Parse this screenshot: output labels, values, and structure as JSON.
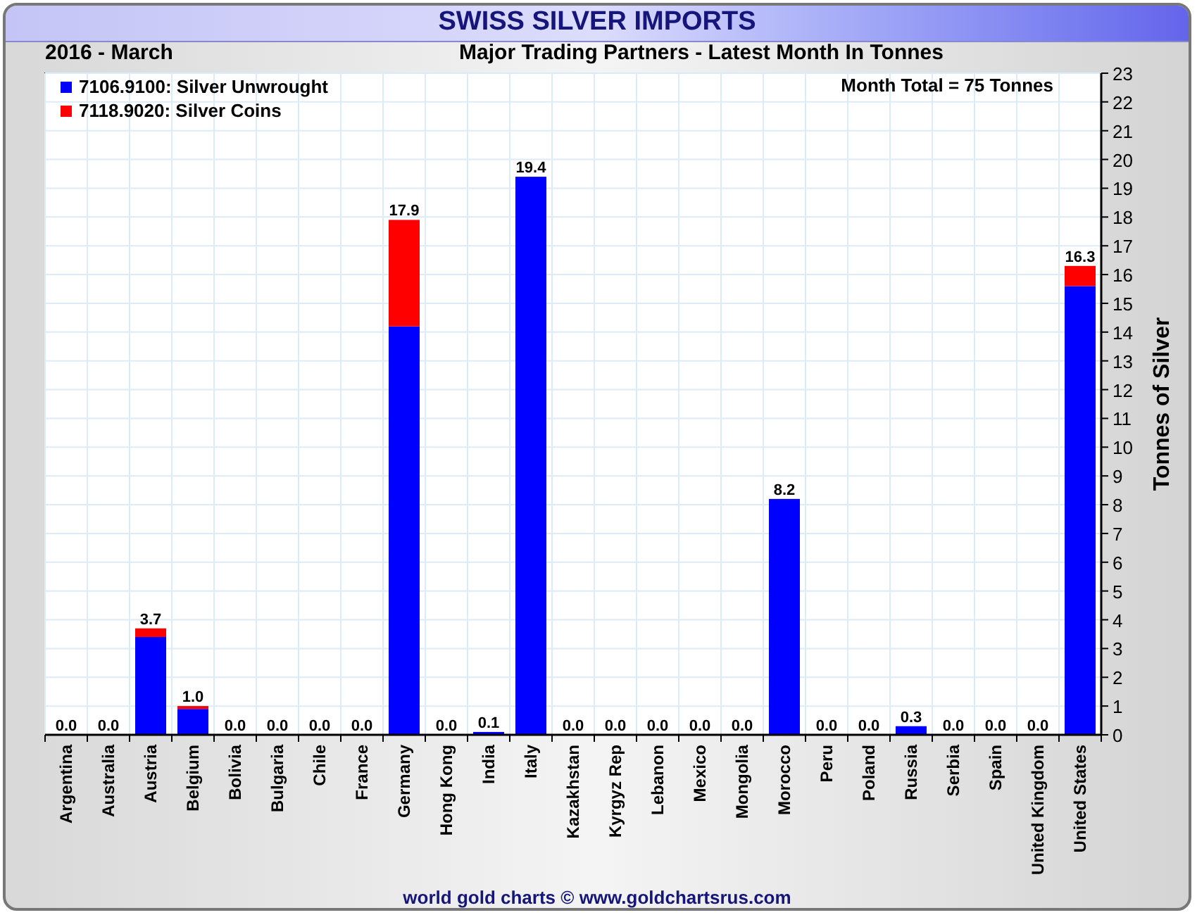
{
  "header": {
    "title": "SWISS SILVER IMPORTS"
  },
  "period": "2016 - March",
  "chart_data": {
    "type": "bar",
    "stacked": true,
    "title": "Major Trading Partners - Latest Month In Tonnes",
    "ylabel": "Tonnes of Silver",
    "categories": [
      "Argentina",
      "Australia",
      "Austria",
      "Belgium",
      "Bolivia",
      "Bulgaria",
      "Chile",
      "France",
      "Germany",
      "Hong Kong",
      "India",
      "Italy",
      "Kazakhstan",
      "Kyrgyz Rep",
      "Lebanon",
      "Mexico",
      "Mongolia",
      "Morocco",
      "Peru",
      "Poland",
      "Russia",
      "Serbia",
      "Spain",
      "United Kingdom",
      "United States"
    ],
    "series": [
      {
        "name": "7106.9100: Silver Unwrought",
        "color": "#0000ff",
        "values": [
          0,
          0,
          3.4,
          0.9,
          0,
          0,
          0,
          0,
          14.2,
          0,
          0.1,
          19.4,
          0,
          0,
          0,
          0,
          0,
          8.2,
          0,
          0,
          0.3,
          0,
          0,
          0,
          15.6
        ]
      },
      {
        "name": "7118.9020: Silver Coins",
        "color": "#ff0000",
        "values": [
          0,
          0,
          0.3,
          0.1,
          0,
          0,
          0,
          0,
          3.7,
          0,
          0,
          0,
          0,
          0,
          0,
          0,
          0,
          0,
          0,
          0,
          0,
          0,
          0,
          0,
          0.7
        ]
      }
    ],
    "ylim": [
      0,
      23
    ],
    "yticks": [
      0,
      1,
      2,
      3,
      4,
      5,
      6,
      7,
      8,
      9,
      10,
      11,
      12,
      13,
      14,
      15,
      16,
      17,
      18,
      19,
      20,
      21,
      22,
      23
    ],
    "value_labels": [
      "0.0",
      "0.0",
      "3.7",
      "1.0",
      "0.0",
      "0.0",
      "0.0",
      "0.0",
      "17.9",
      "0.0",
      "0.1",
      "19.4",
      "0.0",
      "0.0",
      "0.0",
      "0.0",
      "0.0",
      "8.2",
      "0.0",
      "0.0",
      "0.3",
      "0.0",
      "0.0",
      "0.0",
      "16.3"
    ],
    "annotations": [
      "Month Total = 75 Tonnes"
    ],
    "grid": true,
    "legend": true
  },
  "footer": "world gold charts © www.goldchartsrus.com"
}
